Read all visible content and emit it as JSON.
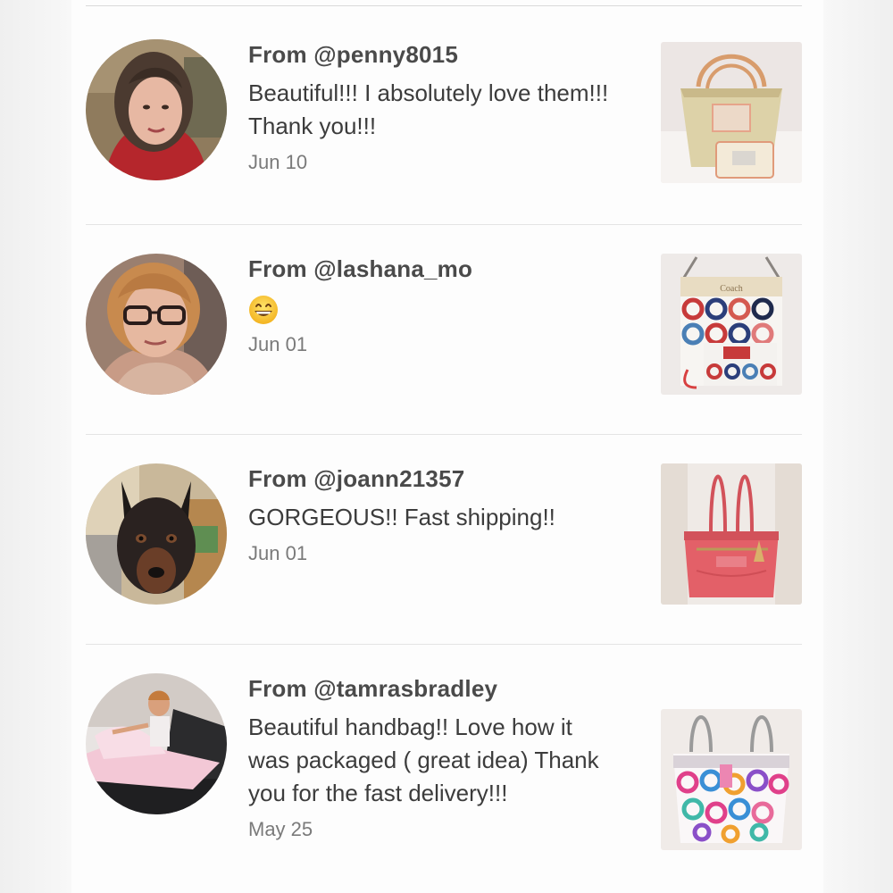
{
  "reviews": [
    {
      "from": "From @penny8015",
      "comment": "Beautiful!!! I absolutely love them!!! Thank you!!!",
      "date": "Jun 10",
      "avatar_icon": "user-photo-woman",
      "thumb_icon": "gold-tote-with-wristlet"
    },
    {
      "from": "From @lashana_mo",
      "comment": "",
      "emoji": "grinning-face-emoji",
      "date": "Jun 01",
      "avatar_icon": "user-photo-woman-glasses",
      "thumb_icon": "colorful-op-art-crossbody"
    },
    {
      "from": "From @joann21357",
      "comment": "GORGEOUS!! Fast shipping!!",
      "date": "Jun 01",
      "avatar_icon": "user-photo-dog",
      "thumb_icon": "coral-pink-tote"
    },
    {
      "from": "From @tamrasbradley",
      "comment": "Beautiful handbag!!  Love how it was packaged ( great idea) Thank you for the fast delivery!!!",
      "date": "May 25",
      "avatar_icon": "user-photo-woman-car",
      "thumb_icon": "multicolor-signature-tote"
    }
  ],
  "colors": {
    "username": "#4a4a4a",
    "comment": "#3c3c3c",
    "date": "#7a7a7a",
    "divider": "#e4e4e4"
  }
}
